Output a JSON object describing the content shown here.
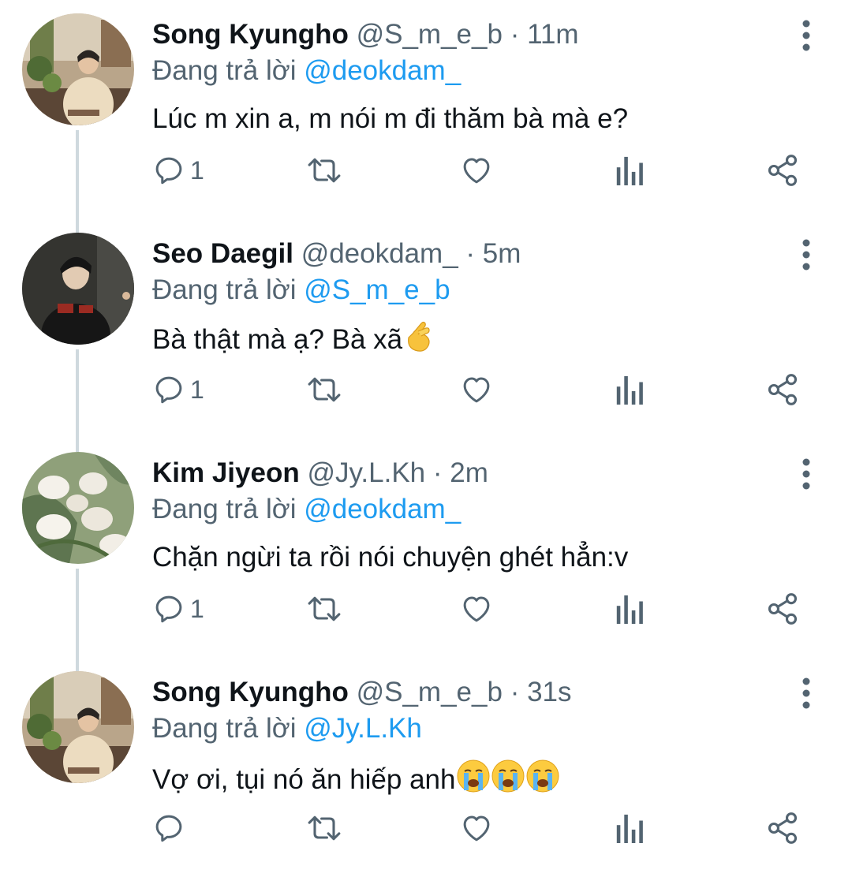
{
  "thread": {
    "replying_prefix": "Đang trả lời",
    "tweets": [
      {
        "name": "Song Kyungho",
        "handle": "@S_m_e_b",
        "separator": "·",
        "time": "11m",
        "replying_to": "@deokdam_",
        "text": "Lúc m xin a, m nói m đi thăm bà mà e?",
        "emoji": [],
        "reply_count": "1",
        "avatar": "man-cafe-avatar"
      },
      {
        "name": "Seo Daegil",
        "handle": "@deokdam_",
        "separator": "·",
        "time": "5m",
        "replying_to": "@S_m_e_b",
        "text": "Bà thật mà ạ? Bà xã",
        "emoji": [
          "finger-heart-emoji"
        ],
        "reply_count": "1",
        "avatar": "man-dark-avatar"
      },
      {
        "name": "Kim Jiyeon",
        "handle": "@Jy.L.Kh",
        "separator": "·",
        "time": "2m",
        "replying_to": "@deokdam_",
        "text": "Chặn ngừi ta rồi nói chuyện ghét hẳn:v",
        "emoji": [],
        "reply_count": "1",
        "avatar": "white-tulips-avatar"
      },
      {
        "name": "Song Kyungho",
        "handle": "@S_m_e_b",
        "separator": "·",
        "time": "31s",
        "replying_to": "@Jy.L.Kh",
        "text": "Vợ ơi, tụi nó ăn hiếp anh",
        "emoji": [
          "loudly-crying-emoji",
          "loudly-crying-emoji",
          "loudly-crying-emoji"
        ],
        "reply_count": "",
        "avatar": "man-cafe-avatar"
      }
    ]
  },
  "colors": {
    "name": "#0f1419",
    "secondary": "#536471",
    "mention": "#1d9bf0",
    "thread_line": "#cfd9de"
  }
}
